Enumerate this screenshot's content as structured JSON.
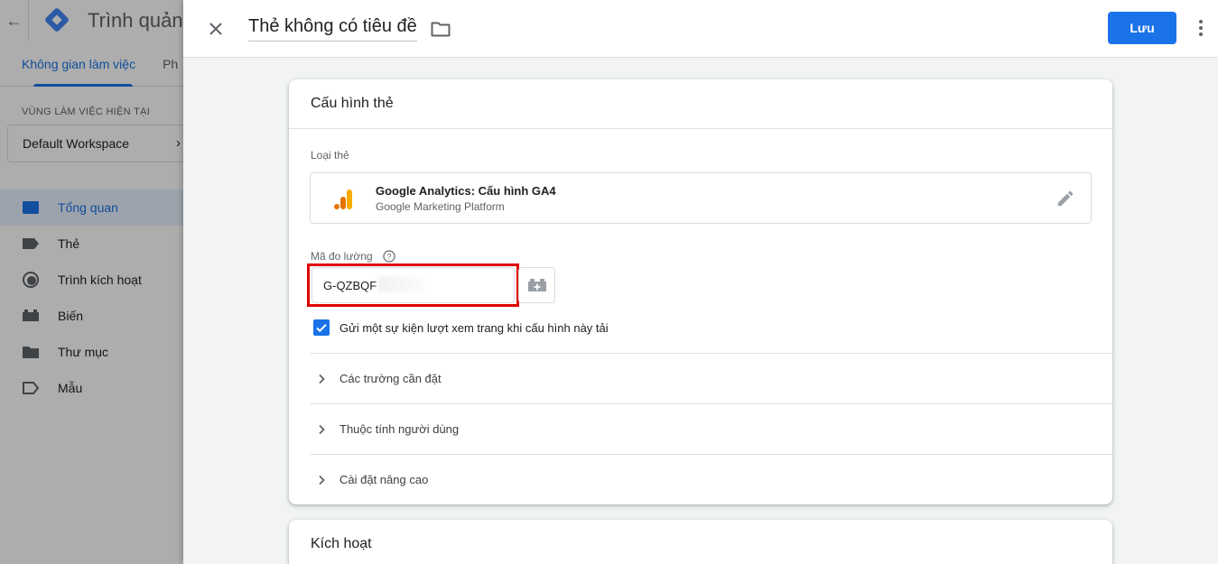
{
  "background": {
    "app_title": "Trình quản",
    "tabs": {
      "active": "Không gian làm việc",
      "next": "Ph"
    },
    "workspace_label": "VÙNG LÀM VIỆC HIỆN TẠI",
    "workspace_name": "Default Workspace",
    "nav": [
      {
        "label": "Tổng quan",
        "icon": "overview-icon",
        "active": true
      },
      {
        "label": "Thẻ",
        "icon": "tag-icon",
        "active": false
      },
      {
        "label": "Trình kích hoạt",
        "icon": "trigger-icon",
        "active": false
      },
      {
        "label": "Biến",
        "icon": "variable-icon",
        "active": false
      },
      {
        "label": "Thư mục",
        "icon": "folder-icon",
        "active": false
      },
      {
        "label": "Mẫu",
        "icon": "template-icon",
        "active": false
      }
    ]
  },
  "panel": {
    "tag_title": "Thẻ không có tiêu đề",
    "save_label": "Lưu"
  },
  "config": {
    "title": "Cấu hình thẻ",
    "tag_type_label": "Loại thẻ",
    "tag_type_name": "Google Analytics: Cấu hình GA4",
    "tag_type_sub": "Google Marketing Platform",
    "measurement_label": "Mã đo lường",
    "measurement_value": "G-QZBQF",
    "checkbox_label": "Gửi một sự kiện lượt xem trang khi cấu hình này tải",
    "checkbox_checked": true,
    "sections": [
      "Các trường cần đặt",
      "Thuộc tính người dùng",
      "Cài đặt nâng cao"
    ]
  },
  "trigger": {
    "title": "Kích hoạt"
  },
  "colors": {
    "accent": "#1a73e8",
    "highlight": "#e00000",
    "ga_orange": "#f9ab00",
    "ga_dark_orange": "#e37400"
  }
}
